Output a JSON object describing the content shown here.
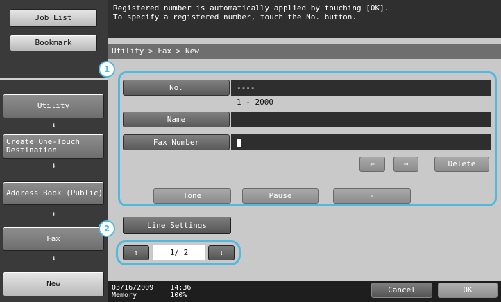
{
  "sidebar": {
    "job_list": "Job List",
    "bookmark": "Bookmark",
    "utility": "Utility",
    "create_one_touch": "Create One-Touch Destination",
    "address_book": "Address Book (Public)",
    "fax": "Fax",
    "new": "New",
    "arrow_glyph": "⬇"
  },
  "message": {
    "line1": "Registered number is automatically applied by touching [OK].",
    "line2": "To specify a registered number, touch the No. button."
  },
  "breadcrumb": "Utility > Fax > New",
  "callouts": {
    "one": "1",
    "two": "2"
  },
  "form": {
    "no_label": "No.",
    "no_value": "----",
    "no_range": "1 - 2000",
    "name_label": "Name",
    "name_value": "",
    "fax_number_label": "Fax Number",
    "left_arrow": "←",
    "right_arrow": "→",
    "delete_label": "Delete",
    "tone_label": "Tone",
    "pause_label": "Pause",
    "dash_label": "-"
  },
  "line_settings": "Line Settings",
  "pager": {
    "up": "↑",
    "page": "1/ 2",
    "down": "↓"
  },
  "footer": {
    "date": "03/16/2009",
    "time": "14:36",
    "memory_label": "Memory",
    "memory_value": "100%",
    "cancel": "Cancel",
    "ok": "OK"
  },
  "colors": {
    "callout": "#50b9df",
    "background": "#c9c9c9",
    "dark": "#2e2e2e"
  }
}
